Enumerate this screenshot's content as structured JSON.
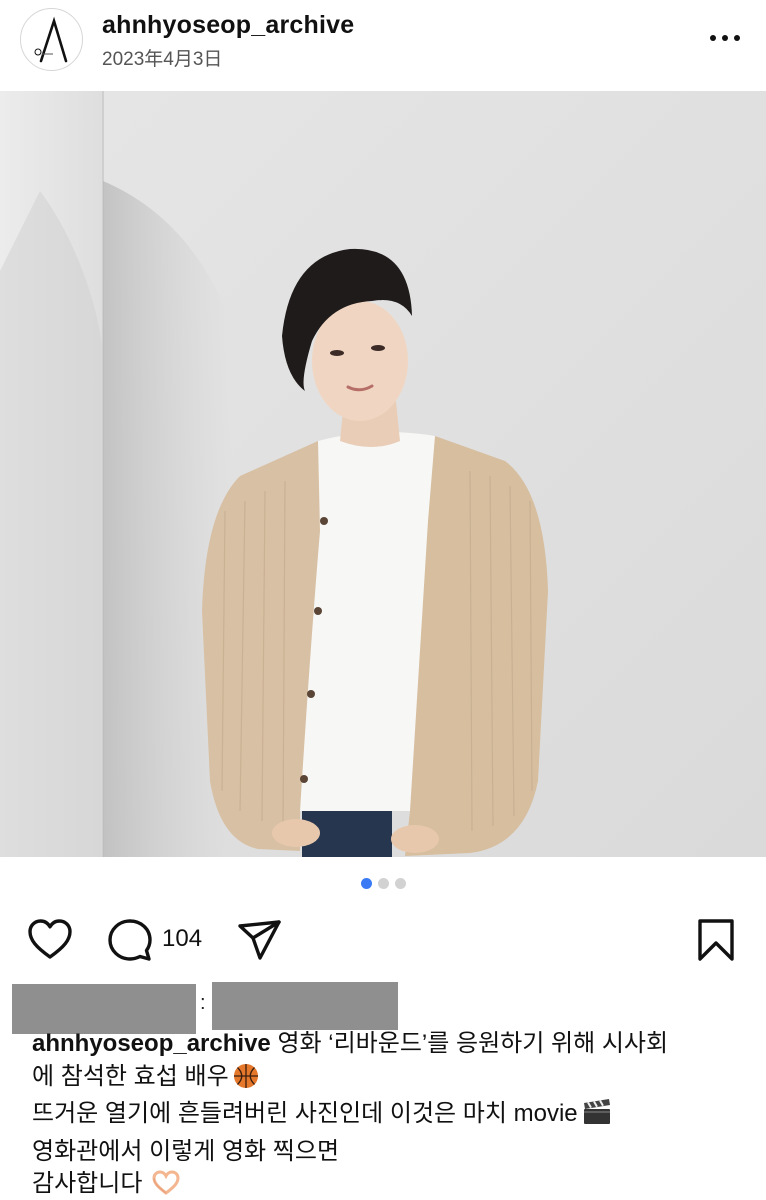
{
  "post": {
    "username": "ahnhyoseop_archive",
    "date": "2023年4月3日",
    "comment_count": "104",
    "carousel": {
      "total": 3,
      "active": 1
    }
  },
  "icons": {
    "avatar": "logo-avatar",
    "more": "more-options-icon",
    "like": "heart-icon",
    "comment": "comment-bubble-icon",
    "share": "paper-plane-icon",
    "save": "bookmark-icon",
    "basketball": "basketball-emoji",
    "clapper": "clapper-board-emoji",
    "heart_hands": "heart-hands-emoji"
  },
  "colors": {
    "carousel_active": "#3a7bf5",
    "carousel_inactive": "#d2d2d2",
    "redaction": "#8f8f8f"
  },
  "caption": {
    "username": "ahnhyoseop_archive",
    "line1": "영화 ‘리바운드’를 응원하기 위해 시사회",
    "line2": "에 참석한 효섭 배우",
    "line3": "뜨거운 열기에 흔들려버린 사진인데 이것은 마치 movie",
    "line4": "영화관에서 이렇게 영화 찍으면",
    "line5": "감사합니다"
  },
  "redacted": {
    "separator": ":"
  }
}
